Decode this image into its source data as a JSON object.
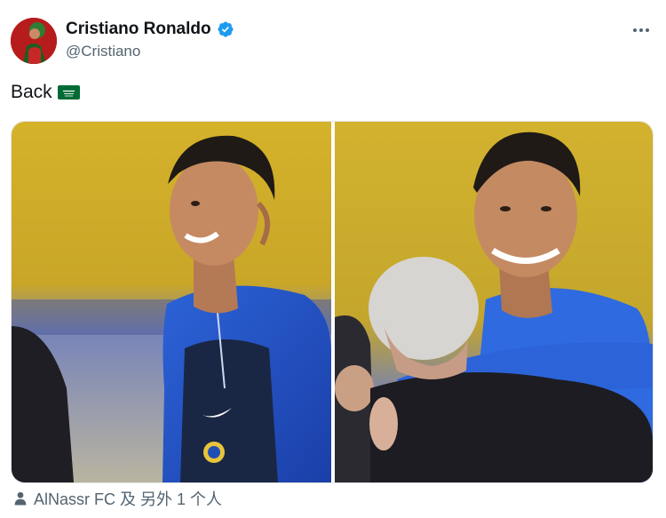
{
  "author": {
    "name": "Cristiano Ronaldo",
    "handle": "@Cristiano",
    "verified": true
  },
  "tweet": {
    "text": "Back",
    "emoji": "saudi-flag"
  },
  "media": {
    "photo_count": 2
  },
  "tags": {
    "text": "AlNassr FC 及 另外 1 个人"
  },
  "colors": {
    "verified_badge": "#1d9bf0",
    "secondary_text": "#536471",
    "flag_green": "#006c35"
  }
}
